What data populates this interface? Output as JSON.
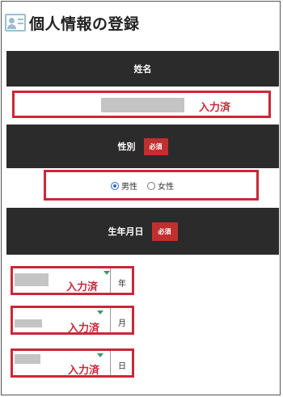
{
  "page": {
    "title": "個人情報の登録",
    "title_icon": "profile-card-icon"
  },
  "name_section": {
    "header": "姓名",
    "status": "入力済"
  },
  "gender_section": {
    "header": "性別",
    "required_badge": "必須",
    "options": [
      {
        "label": "男性",
        "checked": true
      },
      {
        "label": "女性",
        "checked": false
      }
    ]
  },
  "birth_section": {
    "header": "生年月日",
    "required_badge": "必須",
    "year": {
      "status": "入力済",
      "unit": "年"
    },
    "month": {
      "status": "入力済",
      "unit": "月"
    },
    "day": {
      "status": "入力済",
      "unit": "日"
    }
  },
  "colors": {
    "header_bar": "#2b2b2b",
    "required_badge": "#c22f2f",
    "highlight_border": "#c9283a",
    "status_text": "#c9283a",
    "radio_selected": "#2a6bd1"
  }
}
